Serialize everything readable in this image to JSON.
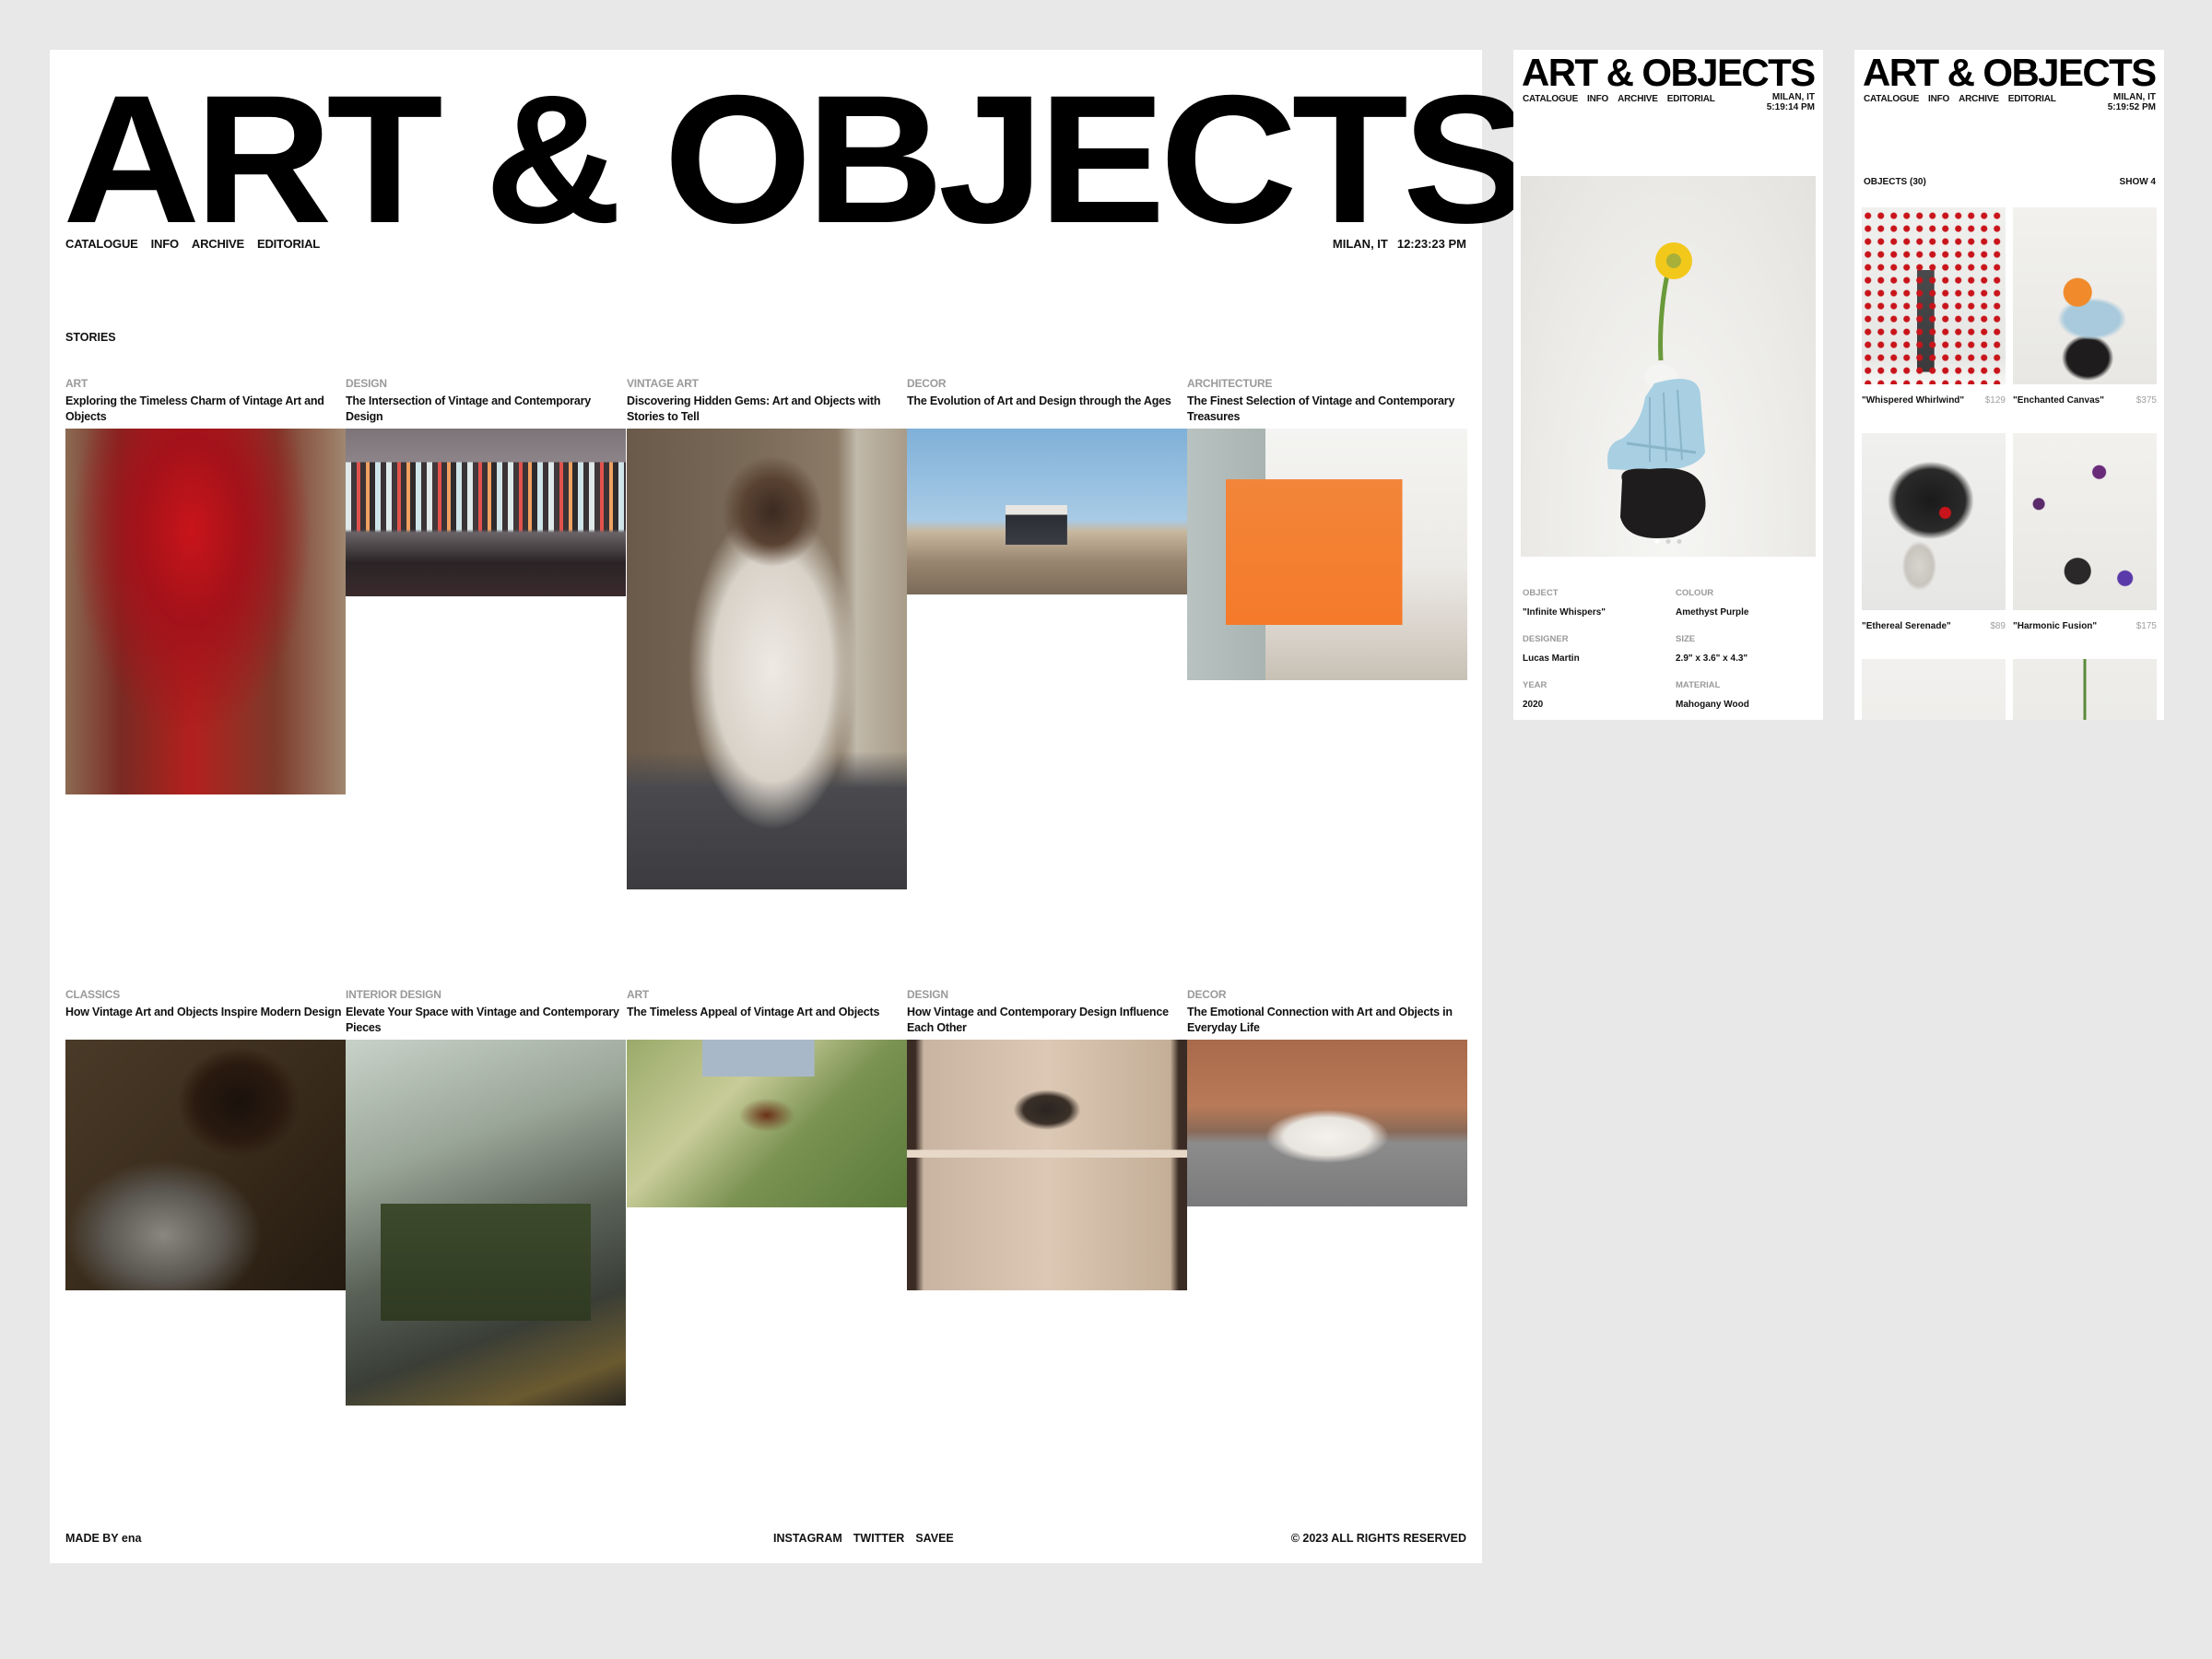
{
  "brand": "ART & OBJECTS",
  "nav": [
    "CATALOGUE",
    "INFO",
    "ARCHIVE",
    "EDITORIAL"
  ],
  "desktop": {
    "location": "MILAN, IT",
    "time": "12:23:23 PM",
    "section_label": "STORIES",
    "stories": [
      {
        "category": "ART",
        "title": "Exploring the Timeless Charm of Vintage Art and Objects",
        "image": "blurred-red-abstract"
      },
      {
        "category": "DESIGN",
        "title": "The Intersection of Vintage and Contemporary Design",
        "image": "neon-light-tubes-gallery"
      },
      {
        "category": "VINTAGE ART",
        "title": "Discovering Hidden Gems: Art and Objects with Stories to Tell",
        "image": "bearded-man-suspenders"
      },
      {
        "category": "DECOR",
        "title": "The Evolution of Art and Design through the Ages",
        "image": "desert-storefront"
      },
      {
        "category": "ARCHITECTURE",
        "title": "The Finest Selection of Vintage and Contemporary Treasures",
        "image": "orange-painting-gallery"
      },
      {
        "category": "CLASSICS",
        "title": "How Vintage Art and Objects Inspire Modern Design",
        "image": "pensive-man-portrait"
      },
      {
        "category": "INTERIOR DESIGN",
        "title": "Elevate Your Space with Vintage and Contemporary Pieces",
        "image": "green-leather-chair"
      },
      {
        "category": "ART",
        "title": "The Timeless Appeal of Vintage Art and Objects",
        "image": "shoes-on-grass"
      },
      {
        "category": "DESIGN",
        "title": "How Vintage and Contemporary Design Influence Each Other",
        "image": "bowl-on-shelf-interior"
      },
      {
        "category": "DECOR",
        "title": "The Emotional Connection with Art and Objects in Everyday Life",
        "image": "white-porsche-road"
      }
    ],
    "footer": {
      "made_by": "MADE BY ena",
      "links": [
        "INSTAGRAM",
        "TWITTER",
        "SAVEE"
      ],
      "copyright": "© 2023 ALL RIGHTS RESERVED"
    }
  },
  "mobile_product": {
    "location": "MILAN, IT",
    "time": "5:19:14 PM",
    "image": "blue-vase-yellow-flower",
    "carousel": {
      "count": 3,
      "active": 1
    },
    "specs": [
      {
        "label": "OBJECT",
        "value": "\"Infinite Whispers\""
      },
      {
        "label": "COLOUR",
        "value": "Amethyst Purple"
      },
      {
        "label": "DESIGNER",
        "value": "Lucas Martin"
      },
      {
        "label": "SIZE",
        "value": "2.9\" x 3.6\" x 4.3\""
      },
      {
        "label": "YEAR",
        "value": "2020"
      },
      {
        "label": "MATERIAL",
        "value": "Mahogany Wood"
      }
    ]
  },
  "mobile_catalogue": {
    "location": "MILAN, IT",
    "time": "5:19:52 PM",
    "objects_label": "OBJECTS (30)",
    "show_label": "SHOW 4",
    "objects": [
      {
        "name": "\"Whispered Whirlwind\"",
        "price": "$129",
        "image": "red-berries-sculpture"
      },
      {
        "name": "\"Enchanted Canvas\"",
        "price": "$375",
        "image": "orange-on-blue-vase"
      },
      {
        "name": "\"Ethereal Serenade\"",
        "price": "$89",
        "image": "black-fan-sculpture"
      },
      {
        "name": "\"Harmonic Fusion\"",
        "price": "$175",
        "image": "purple-flowers-sculpture"
      },
      {
        "name": "",
        "price": "",
        "image": "pink-dried-flowers"
      },
      {
        "name": "",
        "price": "",
        "image": "yellow-flower-vase"
      }
    ]
  },
  "colors": {
    "background": "#e9e8e9",
    "page": "#ffffff",
    "text": "#111111",
    "muted": "#9a9a9a"
  }
}
